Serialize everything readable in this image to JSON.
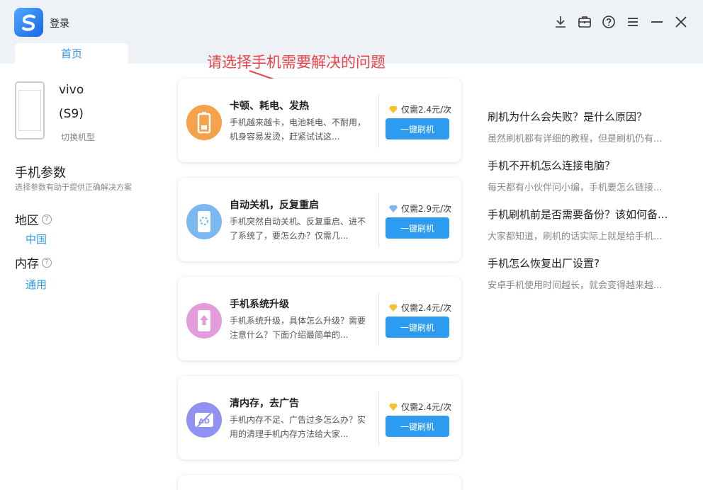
{
  "titlebar": {
    "login_label": "登录",
    "icons": [
      "download-icon",
      "toolbox-icon",
      "help-icon",
      "menu-icon",
      "minimize-icon",
      "close-icon"
    ]
  },
  "tabs": [
    {
      "label": "首页",
      "active": true
    }
  ],
  "device": {
    "brand": "vivo",
    "model": "(S9)",
    "switch_label": "切换机型"
  },
  "params": {
    "title": "手机参数",
    "desc": "选择参数有助于提供正确解决方案",
    "region": {
      "label": "地区",
      "value": "中国"
    },
    "memory": {
      "label": "内存",
      "value": "通用"
    }
  },
  "annotation": "请选择手机需要解决的问题",
  "cards": [
    {
      "title": "卡顿、耗电、发热",
      "desc": "手机越来越卡，电池耗电、不耐用，机身容易发烫，赶紧试试这...",
      "price": "仅需2.4元/次",
      "button": "一键刷机",
      "icon": "battery-icon",
      "color": "#f7a24a",
      "diamond": "gold"
    },
    {
      "title": "自动关机，反复重启",
      "desc": "手机突然自动关机、反复重启、进不了系统了，要怎么办？仅需几...",
      "price": "仅需2.9元/次",
      "button": "一键刷机",
      "icon": "restart-icon",
      "color": "#7bb8f0",
      "diamond": "blue"
    },
    {
      "title": "手机系统升级",
      "desc": "手机系统升级，具体怎么升级？需要注意什么？下面介绍最简单的...",
      "price": "仅需2.4元/次",
      "button": "一键刷机",
      "icon": "upgrade-icon",
      "color": "#e39bd9",
      "diamond": "gold"
    },
    {
      "title": "清内存，去广告",
      "desc": "手机内存不足、广告过多怎么办？实用的清理手机内存方法给大家...",
      "price": "仅需2.4元/次",
      "button": "一键刷机",
      "icon": "no-ad-icon",
      "color": "#8f92f2",
      "diamond": "gold"
    }
  ],
  "articles": [
    {
      "title": "刷机为什么会失败？是什么原因？",
      "desc": "虽然刷机都有详细的教程，但是刷机仍有..."
    },
    {
      "title": "手机不开机怎么连接电脑？",
      "desc": "每天都有小伙伴问小编，手机要怎么链接..."
    },
    {
      "title": "手机刷机前是否需要备份？该如何备...",
      "desc": "大家都知道，刷机的话实际上就是给手机..."
    },
    {
      "title": "手机怎么恢复出厂设置?",
      "desc": "安卓手机使用时间越长，就会变得越来越..."
    }
  ]
}
